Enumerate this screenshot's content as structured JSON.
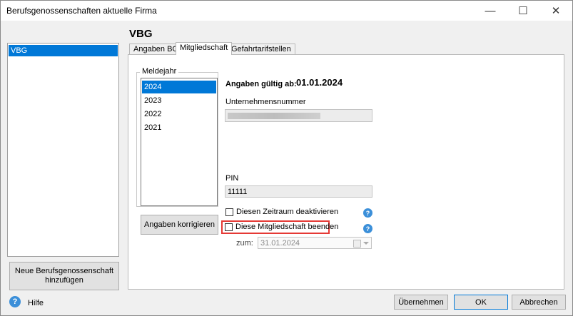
{
  "window": {
    "title": "Berufsgenossenschaften aktuelle Firma",
    "minimize_glyph": "—",
    "maximize_glyph": "☐",
    "close_glyph": "✕"
  },
  "sidebar": {
    "items": [
      {
        "label": "VBG",
        "selected": true
      }
    ],
    "add_button": "Neue Berufsgenossenschaft hinzufügen"
  },
  "main": {
    "heading": "VBG",
    "tabs": [
      {
        "label": "Angaben BG",
        "active": false
      },
      {
        "label": "Mitgliedschaft",
        "active": true
      },
      {
        "label": "Gefahrtarifstellen",
        "active": false
      }
    ],
    "meldejahr": {
      "label": "Meldejahr",
      "years": [
        "2024",
        "2023",
        "2022",
        "2021"
      ],
      "selected": "2024"
    },
    "correct_button": "Angaben korrigieren",
    "valid_from_label": "Angaben gültig ab:",
    "valid_from_value": "01.01.2024",
    "company_number_label": "Unternehmensnummer",
    "company_number_value": "",
    "pin_label": "PIN",
    "pin_value": "11111",
    "deactivate_label": "Diesen Zeitraum deaktivieren",
    "deactivate_checked": false,
    "end_membership_label": "Diese Mitgliedschaft beenden",
    "end_membership_checked": false,
    "zum_label": "zum:",
    "zum_value": "31.01.2024",
    "help_glyph": "?"
  },
  "footer": {
    "help_label": "Hilfe",
    "help_glyph": "?",
    "apply_button": "Übernehmen",
    "ok_button": "OK",
    "cancel_button": "Abbrechen"
  },
  "colors": {
    "selection": "#0078d7",
    "highlight_box": "#e53935",
    "help_icon": "#3b8fd9"
  }
}
